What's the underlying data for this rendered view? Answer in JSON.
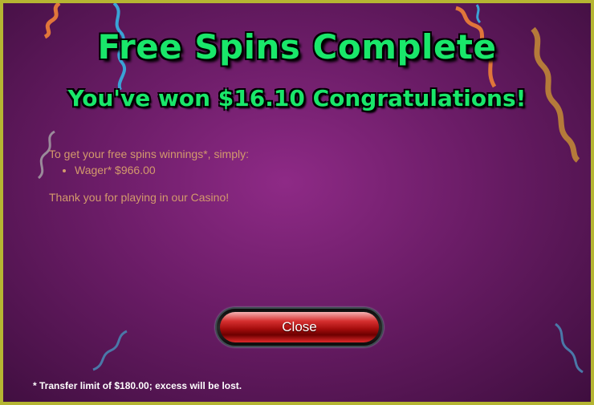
{
  "dialog": {
    "title": "Free Spins Complete",
    "subtitle": "You've won $16.10 Congratulations!",
    "instruction": "To get your free spins winnings*, simply:",
    "requirements": [
      "Wager* $966.00"
    ],
    "thanks": "Thank you for playing in our Casino!",
    "close_label": "Close",
    "footnote": "* Transfer limit of $180.00; excess will be lost."
  },
  "colors": {
    "title_green": "#19e76a",
    "body_text": "#d39a6c",
    "frame": "#b5b532",
    "button_red": "#c01818"
  },
  "decorations": [
    "confetti-streamer-orange",
    "confetti-streamer-blue",
    "confetti-streamer-gold",
    "confetti-streamer-grey"
  ]
}
